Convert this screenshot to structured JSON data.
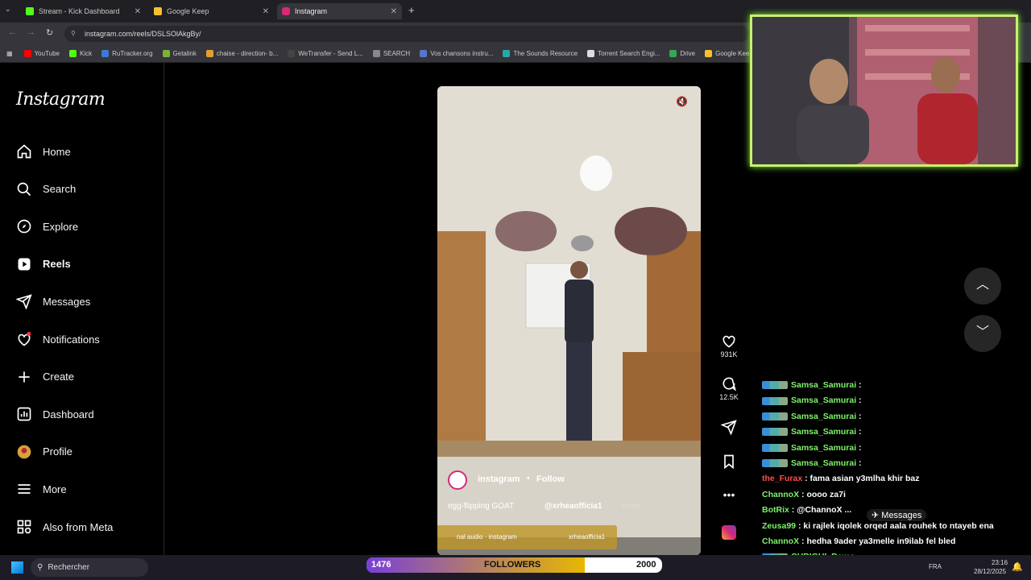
{
  "browser": {
    "tabs": [
      {
        "title": "Stream - Kick Dashboard",
        "color": "#53fc18"
      },
      {
        "title": "Google Keep",
        "color": "#f7c12d"
      },
      {
        "title": "Instagram",
        "color": "#d62976"
      }
    ],
    "url": "instagram.com/reels/DSLSOlAkgBy/",
    "bookmarks": [
      {
        "label": "YouTube",
        "color": "#ff0000"
      },
      {
        "label": "Kick",
        "color": "#53fc18"
      },
      {
        "label": "RuTracker.org",
        "color": "#3a7bd5"
      },
      {
        "label": "Getalink",
        "color": "#7bb33a"
      },
      {
        "label": "chaise - direction- b...",
        "color": "#e0a030"
      },
      {
        "label": "WeTransfer - Send L...",
        "color": "#444"
      },
      {
        "label": "SEARCH",
        "color": "#888"
      },
      {
        "label": "Vos chansons instru...",
        "color": "#5577cc"
      },
      {
        "label": "The Sounds Resource",
        "color": "#2aa"
      },
      {
        "label": "Torrent Search Engi...",
        "color": "#ddd"
      },
      {
        "label": "Drive",
        "color": "#34a853"
      },
      {
        "label": "Google Keep",
        "color": "#f7c12d"
      }
    ]
  },
  "instagram": {
    "logo": "Instagram",
    "nav": [
      {
        "label": "Home",
        "icon": "home-icon"
      },
      {
        "label": "Search",
        "icon": "search-icon"
      },
      {
        "label": "Explore",
        "icon": "compass-icon"
      },
      {
        "label": "Reels",
        "icon": "reels-icon"
      },
      {
        "label": "Messages",
        "icon": "messages-icon"
      },
      {
        "label": "Notifications",
        "icon": "heart-icon"
      },
      {
        "label": "Create",
        "icon": "plus-icon"
      },
      {
        "label": "Dashboard",
        "icon": "dashboard-icon"
      },
      {
        "label": "Profile",
        "icon": "avatar-icon"
      },
      {
        "label": "More",
        "icon": "menu-icon"
      },
      {
        "label": "Also from Meta",
        "icon": "meta-icon"
      }
    ],
    "reel": {
      "username": "instagram",
      "follow": "Follow",
      "caption": "egg-flipping GOAT",
      "mention": "@xrheaofficia1",
      "more": "... more",
      "audio": "nal audio · instagram",
      "audio_user": "xrheaofficia1"
    },
    "actions": {
      "likes": "931K",
      "comments": "12.5K"
    },
    "floating_messages": "Messages"
  },
  "chat": [
    {
      "user": "Samsa_Samurai",
      "msg": "",
      "color": "#7ef36a"
    },
    {
      "user": "Samsa_Samurai",
      "msg": "",
      "color": "#7ef36a"
    },
    {
      "user": "Samsa_Samurai",
      "msg": "",
      "color": "#7ef36a"
    },
    {
      "user": "Samsa_Samurai",
      "msg": "",
      "color": "#7ef36a"
    },
    {
      "user": "Samsa_Samurai",
      "msg": "",
      "color": "#7ef36a"
    },
    {
      "user": "Samsa_Samurai",
      "msg": "",
      "color": "#7ef36a"
    },
    {
      "user": "the_Furax",
      "msg": "fama asian y3mlha khir baz",
      "color": "#ff4d4d"
    },
    {
      "user": "ChannoX",
      "msg": "oooo za7i",
      "color": "#7ef36a"
    },
    {
      "user": "BotRix",
      "msg": "@ChannoX ...",
      "color": "#7ef36a"
    },
    {
      "user": "Zeusa99",
      "msg": "ki rajlek iqolek orqed aala rouhek to ntayeb ena",
      "color": "#7ef36a"
    },
    {
      "user": "ChannoX",
      "msg": "hedha 9ader ya3melle in9ilab fel bled",
      "color": "#7ef36a"
    },
    {
      "user": "CHRIGUI_Baw",
      "msg": "",
      "color": "#7ef36a"
    },
    {
      "user": "the_Furax",
      "msg": "fama asian y3mlha khir baz",
      "color": "#ff4d4d"
    }
  ],
  "taskbar": {
    "search": "Rechercher",
    "followers_current": "1476",
    "followers_label": "FOLLOWERS",
    "followers_goal": "2000",
    "followers_progress": 0.738,
    "lang": "FRA",
    "time": "23:16",
    "date": "28/12/2025"
  }
}
